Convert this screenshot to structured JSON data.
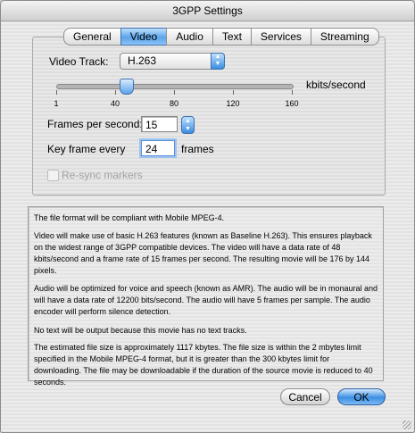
{
  "window": {
    "title": "3GPP Settings"
  },
  "tabs": [
    {
      "label": "General"
    },
    {
      "label": "Video"
    },
    {
      "label": "Audio"
    },
    {
      "label": "Text"
    },
    {
      "label": "Services"
    },
    {
      "label": "Streaming"
    }
  ],
  "active_tab": "Video",
  "video": {
    "track_label": "Video Track:",
    "track_value": "H.263",
    "slider": {
      "ticks": [
        "1",
        "40",
        "80",
        "120",
        "160"
      ],
      "min": 1,
      "max": 160,
      "value": 48,
      "unit_label": "kbits/second"
    },
    "fps_label": "Frames per second:",
    "fps_value": "15",
    "keyframe_label": "Key frame every",
    "keyframe_value": "24",
    "keyframe_unit": "frames",
    "resync_label": "Re-sync markers",
    "resync_checked": false
  },
  "summary": [
    "The file format will be compliant with Mobile MPEG-4.",
    "Video will make use of basic H.263 features (known as Baseline H.263).  This ensures playback on the widest range of 3GPP compatible devices.  The video will have a data rate of 48 kbits/second and a frame rate of 15 frames per second.  The resulting movie will be 176 by 144 pixels.",
    "Audio will be optimized for voice and speech (known as AMR).  The audio will be in monaural and will have a data rate of 12200 bits/second. The audio will have 5 frames per sample.  The audio encoder will perform silence detection.",
    "No text will be output because this movie has no text tracks.",
    "The estimated file size is approximately 1117 kbytes. The file size is within the 2 mbytes limit specified in the Mobile MPEG-4 format, but it is greater than the 300 kbytes limit for downloading. The file may be downloadable if the duration of the source movie is reduced to 40 seconds."
  ],
  "buttons": {
    "cancel": "Cancel",
    "ok": "OK"
  }
}
